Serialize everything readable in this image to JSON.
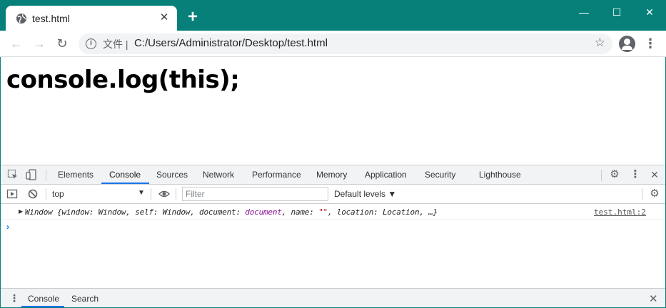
{
  "browser": {
    "tab_title": "test.html",
    "tab_close": "✕",
    "new_tab": "+",
    "window_controls": {
      "minimize": "—",
      "maximize": "☐",
      "close": "✕"
    },
    "url_scheme": "文件 |",
    "url": "C:/Users/Administrator/Desktop/test.html"
  },
  "page": {
    "heading": "console.log(this);"
  },
  "devtools": {
    "tabs": [
      "Elements",
      "Console",
      "Sources",
      "Network",
      "Performance",
      "Memory",
      "Application",
      "Security",
      "Lighthouse"
    ],
    "active_tab": "Console",
    "context": "top",
    "filter_placeholder": "Filter",
    "levels": "Default levels ▼",
    "log": {
      "prefix": "Window {window: Window, self: Window, document: ",
      "document_kw": "document",
      "mid": ", name: ",
      "name_str": "\"\"",
      "suffix": ", location: Location, …}",
      "source": "test.html:2"
    },
    "prompt": "›",
    "drawer_tabs": [
      "Console",
      "Search"
    ]
  },
  "icons": [
    "globe-icon",
    "back-icon",
    "forward-icon",
    "reload-icon",
    "info-icon",
    "star-icon",
    "profile-icon",
    "menu-icon",
    "inspect-icon",
    "device-icon",
    "settings-icon",
    "kebab-icon",
    "close-icon",
    "sidebar-icon",
    "clear-icon",
    "eye-icon"
  ],
  "colors": {
    "titlebar": "#07807a",
    "accent": "#1a73e8"
  }
}
